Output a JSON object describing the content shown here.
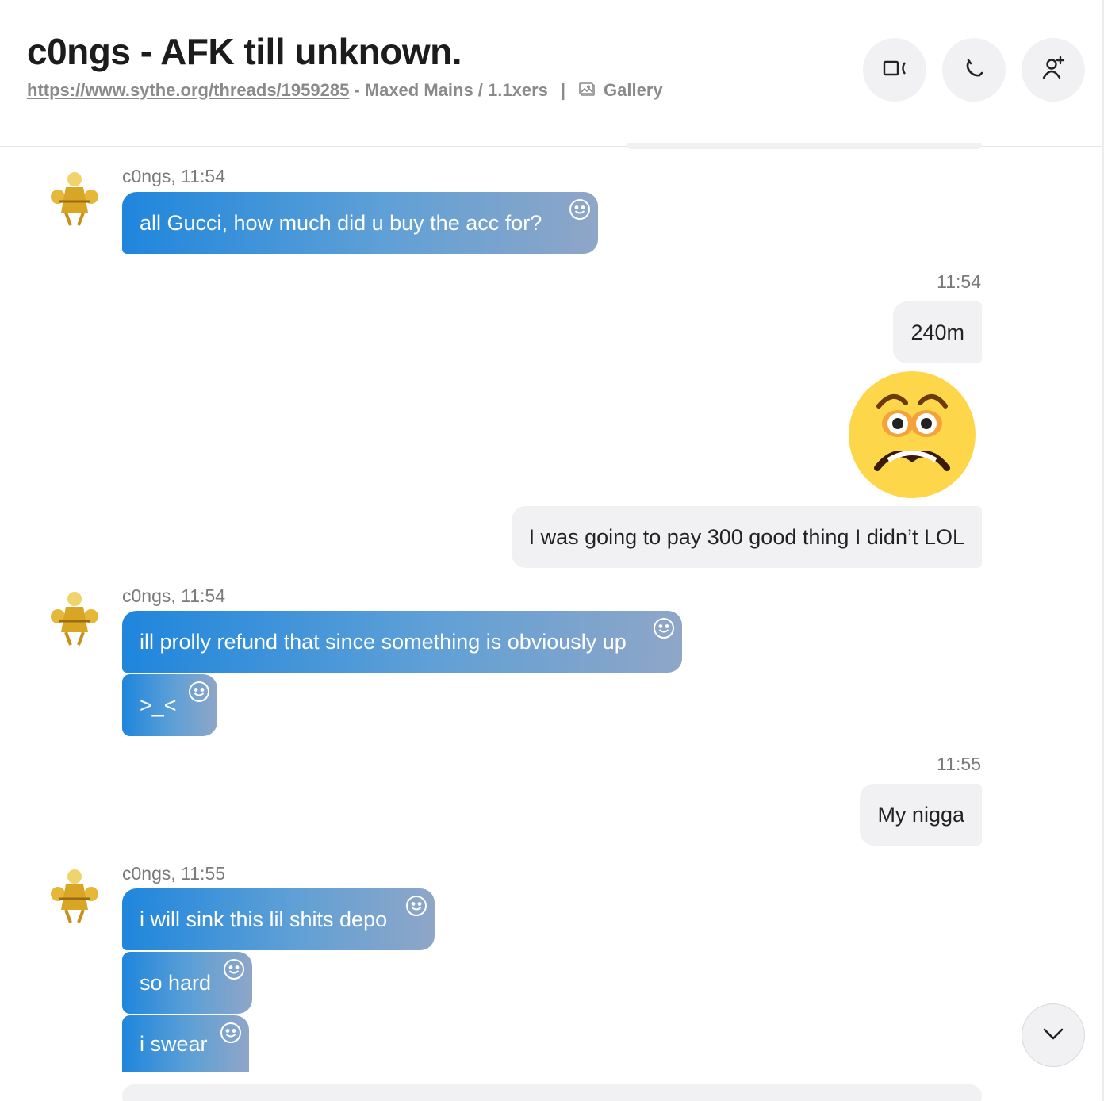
{
  "header": {
    "title": "c0ngs - AFK till unknown.",
    "link": "https://www.sythe.org/threads/1959285",
    "link_suffix": "- Maxed Mains / 1.1xers",
    "separator": "|",
    "gallery_label": "Gallery",
    "buttons": {
      "video": "video-call-icon",
      "call": "phone-icon",
      "add_person": "add-person-icon"
    }
  },
  "messages": [
    {
      "side": "in",
      "sender": "c0ngs, 11:54",
      "bubbles": [
        "all Gucci, how much did u buy the acc for?"
      ]
    },
    {
      "side": "out",
      "time": "11:54",
      "bubbles": [
        "240m"
      ],
      "emoji": "worried-face-emoji",
      "after_emoji": "I was going to pay 300 good thing I didn’t LOL"
    },
    {
      "side": "in",
      "sender": "c0ngs, 11:54",
      "bubbles": [
        "ill prolly refund that since something is obviously up",
        ">_<"
      ]
    },
    {
      "side": "out",
      "time": "11:55",
      "bubbles": [
        "My nigga"
      ]
    },
    {
      "side": "in",
      "sender": "c0ngs, 11:55",
      "bubbles": [
        "i will sink this lil shits depo",
        "so hard",
        "i swear"
      ]
    }
  ],
  "colors": {
    "incoming_gradient_start": "#1f86dc",
    "incoming_gradient_end": "#8fa6c7",
    "outgoing_bg": "#f1f1f3",
    "emoji_face": "#fdd64a"
  }
}
